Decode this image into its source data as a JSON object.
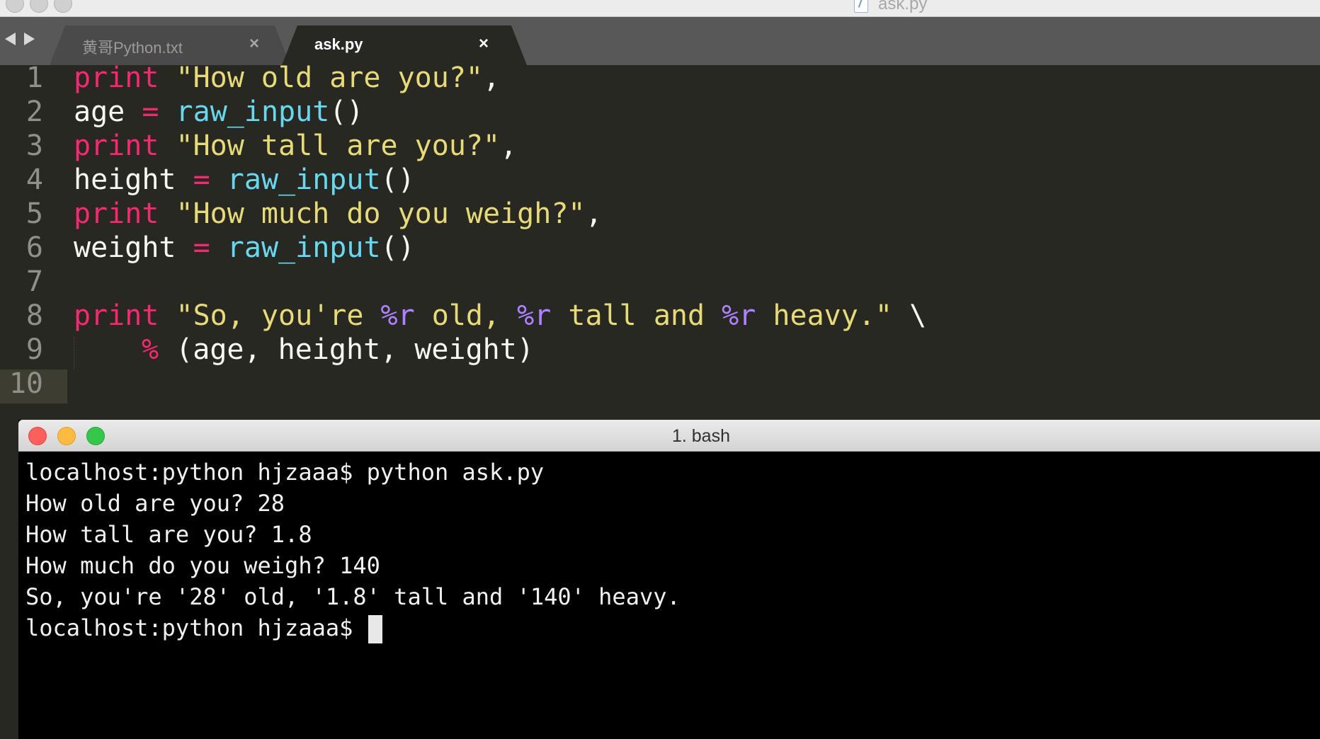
{
  "editor": {
    "window_title": "ask.py",
    "tabs": [
      {
        "label": "黄哥Python.txt",
        "close": "×",
        "active": false
      },
      {
        "label": "ask.py",
        "close": "×",
        "active": true
      }
    ],
    "line_numbers": [
      "1",
      "2",
      "3",
      "4",
      "5",
      "6",
      "7",
      "8",
      "9",
      "10"
    ],
    "code": {
      "l1": {
        "kw": "print",
        "str": "\"How old are you?\"",
        "rest": ","
      },
      "l2": {
        "var": "age",
        "op": "=",
        "fn": "raw_input",
        "paren": "()"
      },
      "l3": {
        "kw": "print",
        "str": "\"How tall are you?\"",
        "rest": ","
      },
      "l4": {
        "var": "height",
        "op": "=",
        "fn": "raw_input",
        "paren": "()"
      },
      "l5": {
        "kw": "print",
        "str": "\"How much do you weigh?\"",
        "rest": ","
      },
      "l6": {
        "var": "weight",
        "op": "=",
        "fn": "raw_input",
        "paren": "()"
      },
      "l8": {
        "kw": "print",
        "s1": "\"So, you're ",
        "f1": "%r",
        "s2": " old, ",
        "f2": "%r",
        "s3": " tall and ",
        "f3": "%r",
        "s4": " heavy.\"",
        "rest": " \\"
      },
      "l9": {
        "op": "%",
        "rest": " (age, height, weight)"
      }
    }
  },
  "terminal": {
    "title": "1. bash",
    "lines": [
      "localhost:python hjzaaa$ python ask.py",
      "How old are you? 28",
      "How tall are you? 1.8",
      "How much do you weigh? 140",
      "So, you're '28' old, '1.8' tall and '140' heavy."
    ],
    "prompt": "localhost:python hjzaaa$ "
  },
  "colors": {
    "editor_bg": "#272822",
    "keyword": "#f92672",
    "string": "#e6db74",
    "function": "#66d9ef",
    "format_spec": "#ae81ff",
    "terminal_bg": "#000000"
  }
}
